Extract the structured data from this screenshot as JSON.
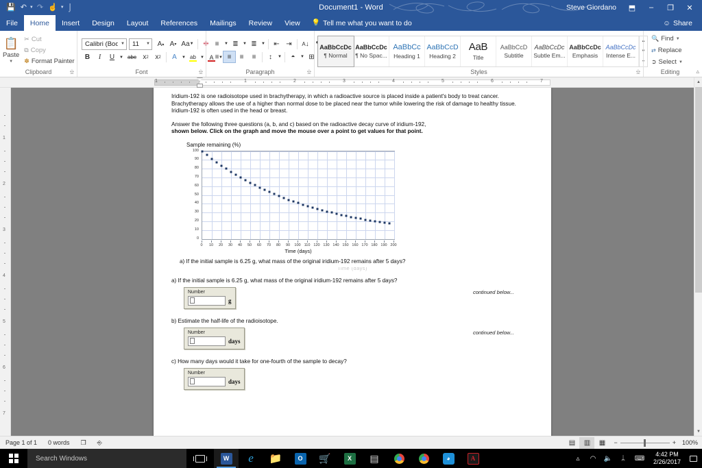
{
  "titlebar": {
    "document_title": "Document1  -  Word",
    "account_name": "Steve Giordano",
    "quick_access": [
      {
        "name": "save-icon",
        "glyph": "⬚"
      },
      {
        "name": "undo-icon",
        "glyph": "↶"
      },
      {
        "name": "redo-icon",
        "glyph": "↷"
      },
      {
        "name": "touch-mode-icon",
        "glyph": "☝"
      },
      {
        "name": "customize-qat-icon",
        "glyph": "⌵"
      }
    ],
    "window_controls": {
      "ribbon_display_options": "⬒",
      "minimize": "─",
      "restore": "❐",
      "close": "✕"
    }
  },
  "tabs": [
    {
      "label": "File",
      "active": false
    },
    {
      "label": "Home",
      "active": true
    },
    {
      "label": "Insert",
      "active": false
    },
    {
      "label": "Design",
      "active": false
    },
    {
      "label": "Layout",
      "active": false
    },
    {
      "label": "References",
      "active": false
    },
    {
      "label": "Mailings",
      "active": false
    },
    {
      "label": "Review",
      "active": false
    },
    {
      "label": "View",
      "active": false
    }
  ],
  "tell_me": "Tell me what you want to do",
  "share_label": "Share",
  "ribbon": {
    "clipboard": {
      "label": "Clipboard",
      "paste": "Paste",
      "cut": "Cut",
      "copy": "Copy",
      "format_painter": "Format Painter"
    },
    "font": {
      "label": "Font",
      "font_name": "Calibri (Body)",
      "font_size": "11",
      "grow_font": "A",
      "shrink_font": "A",
      "change_case": "Aa",
      "clear_formatting": "✐",
      "bold": "B",
      "italic": "I",
      "underline": "U",
      "strikethrough": "abc",
      "subscript": "x₂",
      "superscript": "x²",
      "text_effects": "A",
      "highlight": "ab",
      "font_color": "A"
    },
    "paragraph": {
      "label": "Paragraph",
      "bullets": "≡",
      "numbering": "≣",
      "multilevel": "≣",
      "decrease_indent": "⇤",
      "increase_indent": "⇥",
      "sort": "↓",
      "show_marks": "¶",
      "align_left": "≡",
      "align_center": "≡",
      "align_right": "≡",
      "justify": "≡",
      "line_spacing": "↕",
      "shading": "◳",
      "borders": "⊞"
    },
    "styles": {
      "label": "Styles",
      "items": [
        {
          "preview": "AaBbCcDc",
          "name": "¶ Normal",
          "selected": true
        },
        {
          "preview": "AaBbCcDc",
          "name": "¶ No Spac...",
          "selected": false
        },
        {
          "preview": "AaBbCc",
          "name": "Heading 1",
          "selected": false
        },
        {
          "preview": "AaBbCcD",
          "name": "Heading 2",
          "selected": false
        },
        {
          "preview": "AaB",
          "name": "Title",
          "selected": false
        },
        {
          "preview": "AaBbCcD",
          "name": "Subtitle",
          "selected": false
        },
        {
          "preview": "AaBbCcDc",
          "name": "Subtle Em...",
          "selected": false
        },
        {
          "preview": "AaBbCcDc",
          "name": "Emphasis",
          "selected": false
        },
        {
          "preview": "AaBbCcDc",
          "name": "Intense E...",
          "selected": false
        }
      ]
    },
    "editing": {
      "label": "Editing",
      "find": "Find",
      "replace": "Replace",
      "select": "Select"
    },
    "collapse_ribbon_icon": "∧"
  },
  "document": {
    "paragraph1": "Iridium-192 is one radioisotope used in brachytherapy, in which a radioactive source is placed inside a patient's body to treat cancer. Brachytherapy allows the use of a higher than normal dose to be placed near the tumor while lowering the risk of damage to healthy tissue. Iridium-192 is often used in the head or breast.",
    "paragraph2_a": "Answer the following three questions (a, b, and c) based on the radioactive decay curve of iridium-192,",
    "paragraph2_b": "shown below. Click on the graph and move the mouse over a point to get values for that point.",
    "artifact_text": "Time (days)",
    "question_a_top": "a) If the initial sample is 6.25 g, what mass of the original iridium-192 remains after 5 days?",
    "questions": [
      {
        "text": "a) If the initial sample is 6.25 g, what mass of the original iridium-192 remains after 5 days?",
        "field_label": "Number",
        "field_value": "",
        "unit": "g",
        "continued": "continued below..."
      },
      {
        "text": "b) Estimate the half-life of the radioisotope.",
        "field_label": "Number",
        "field_value": "",
        "unit": "days",
        "continued": "continued below..."
      },
      {
        "text": "c) How many days would it take for one-fourth of the sample to decay?",
        "field_label": "Number",
        "field_value": "",
        "unit": "days",
        "continued": ""
      }
    ]
  },
  "chart_data": {
    "type": "scatter",
    "title": "Sample remaining (%)",
    "xlabel": "Time (days)",
    "ylabel": "",
    "xlim": [
      0,
      200
    ],
    "ylim": [
      0,
      100
    ],
    "xticks": [
      0,
      10,
      20,
      30,
      40,
      50,
      60,
      70,
      80,
      90,
      100,
      110,
      120,
      130,
      140,
      150,
      160,
      170,
      180,
      190,
      200
    ],
    "yticks": [
      0,
      10,
      20,
      30,
      40,
      50,
      60,
      70,
      80,
      90,
      100
    ],
    "grid": true,
    "legend": "none",
    "marker_color": "#1f3864",
    "x": [
      0,
      5,
      10,
      15,
      20,
      25,
      30,
      35,
      40,
      45,
      50,
      55,
      60,
      65,
      70,
      75,
      80,
      85,
      90,
      95,
      100,
      105,
      110,
      115,
      120,
      125,
      130,
      135,
      140,
      145,
      150,
      155,
      160,
      165,
      170,
      175,
      180,
      185,
      190,
      195
    ],
    "values": [
      100.0,
      95.6,
      91.4,
      87.4,
      83.5,
      79.9,
      76.4,
      73.0,
      69.8,
      66.7,
      63.8,
      61.0,
      58.3,
      55.7,
      53.3,
      50.9,
      48.7,
      46.6,
      44.5,
      42.6,
      40.7,
      38.9,
      37.2,
      35.5,
      34.0,
      32.5,
      31.1,
      29.7,
      28.4,
      27.1,
      25.9,
      24.8,
      23.7,
      22.7,
      21.7,
      20.7,
      19.8,
      18.9,
      18.1,
      17.3
    ]
  },
  "statusbar": {
    "page": "Page 1 of 1",
    "words": "0 words",
    "proofing_icon": "⧉",
    "language_icon": "⌗",
    "views": [
      {
        "name": "read-mode",
        "glyph": "▤",
        "active": false
      },
      {
        "name": "print-layout",
        "glyph": "▥",
        "active": true
      },
      {
        "name": "web-layout",
        "glyph": "▦",
        "active": false
      }
    ],
    "zoom_out": "−",
    "zoom_in": "+",
    "zoom_level": "100%"
  },
  "taskbar": {
    "search_placeholder": "Search Windows",
    "apps": [
      {
        "name": "word",
        "glyph": "W",
        "color": "#2b579a",
        "active": true
      },
      {
        "name": "edge",
        "glyph": "e",
        "color": "#0b7dc1",
        "active": false
      },
      {
        "name": "file-explorer",
        "glyph": "▭",
        "color": "#f4c145",
        "active": false
      },
      {
        "name": "outlook",
        "glyph": "O",
        "color": "#0a64ad",
        "active": false
      },
      {
        "name": "microsoft-store",
        "glyph": "▤",
        "color": "#d8d8d8",
        "active": false
      },
      {
        "name": "excel",
        "glyph": "X",
        "color": "#1d6f42",
        "active": false
      },
      {
        "name": "calculator",
        "glyph": "⌸",
        "color": "#d9d9d9",
        "active": false
      },
      {
        "name": "chrome",
        "glyph": "◉",
        "color": "#e8453c",
        "active": false
      },
      {
        "name": "chrome-2",
        "glyph": "◉",
        "color": "#e8453c",
        "active": false
      },
      {
        "name": "blue-app",
        "glyph": "◔",
        "color": "#1e90d8",
        "active": false
      },
      {
        "name": "adobe-reader",
        "glyph": "A",
        "color": "#cc2229",
        "active": false
      }
    ],
    "tray": [
      {
        "name": "show-hidden-icons",
        "glyph": "∧"
      },
      {
        "name": "wifi-icon",
        "glyph": "◠"
      },
      {
        "name": "volume-icon",
        "glyph": "🔊"
      },
      {
        "name": "bluetooth-icon",
        "glyph": "ᛦ"
      },
      {
        "name": "keyboard-icon",
        "glyph": "⌨"
      }
    ],
    "time": "4:42 PM",
    "date": "2/26/2017"
  }
}
